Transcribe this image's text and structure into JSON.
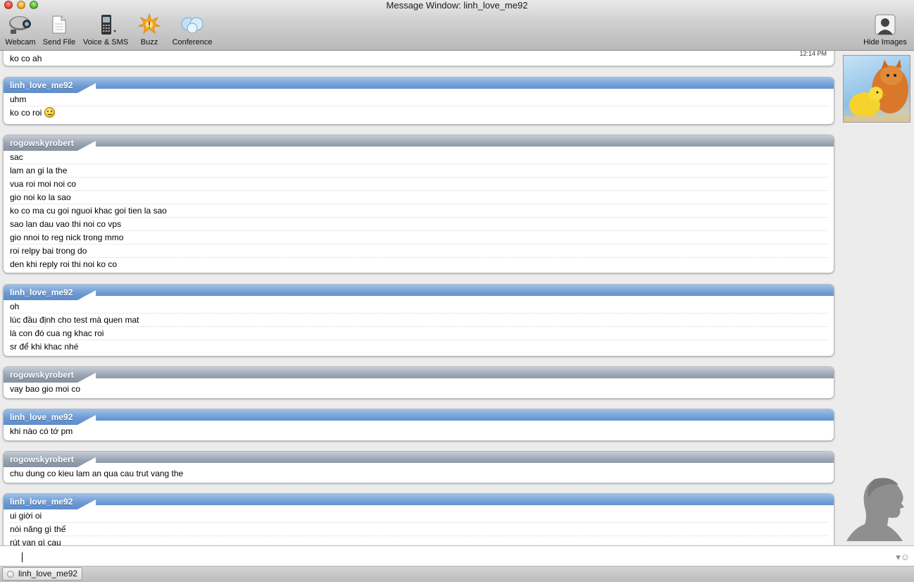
{
  "window": {
    "title": "Message Window: linh_love_me92"
  },
  "toolbar": {
    "webcam": "Webcam",
    "send_file": "Send File",
    "voice_sms": "Voice & SMS",
    "buzz": "Buzz",
    "conference": "Conference",
    "hide_images": "Hide Images"
  },
  "conversation": {
    "first_line": "ko co  ah",
    "first_time": "12:14 PM",
    "blocks": [
      {
        "sender": "linh_love_me92",
        "lines": [
          "uhm",
          "ko co roi"
        ]
      },
      {
        "sender": "rogowskyrobert",
        "lines": [
          "sac",
          "lam an gi la the",
          "vua  roi moi noi co",
          "gio noi ko la sao",
          "ko co ma cu goi nguoi khac goi tien la sao",
          "sao lan dau vao thi noi co  vps",
          "gio nnoi to reg nick trong mmo",
          "roi relpy bai trong do",
          "den khi reply roi thi noi ko co"
        ]
      },
      {
        "sender": "linh_love_me92",
        "lines": [
          "oh",
          "lúc đầu định cho test mà quen mat",
          "là con đó cua ng khac roi",
          "sr để khi khac nhé"
        ]
      },
      {
        "sender": "rogowskyrobert",
        "lines": [
          "vay bao gio moi co"
        ]
      },
      {
        "sender": "linh_love_me92",
        "lines": [
          "khi nào có tớ pm"
        ]
      },
      {
        "sender": "rogowskyrobert",
        "lines": [
          "chu dung co kieu lam  an qua cau trut vang the"
        ]
      },
      {
        "sender": "linh_love_me92",
        "lines": [
          "ui giời oi",
          "nói năng gì thế",
          "rút van gì cau"
        ]
      }
    ]
  },
  "input": {
    "value": ""
  },
  "tabs": [
    {
      "label": "linh_love_me92"
    }
  ],
  "colors": {
    "me_header": "#6d9bd3",
    "them_header": "#98a3b2"
  }
}
